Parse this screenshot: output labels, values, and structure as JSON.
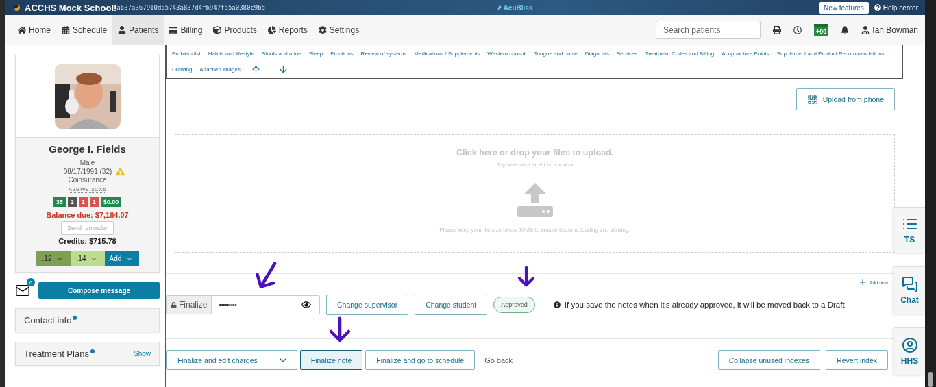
{
  "topbar": {
    "school": "ACCHS Mock School!",
    "hash": "a637a367910d55743a837d4fb947f55a0380c9b5",
    "logo": "AcuBliss",
    "new_features": "New features",
    "help": "Help center"
  },
  "nav": {
    "items": [
      {
        "label": "Home",
        "selected": false
      },
      {
        "label": "Schedule",
        "selected": false
      },
      {
        "label": "Patients",
        "selected": true
      },
      {
        "label": "Billing",
        "selected": false
      },
      {
        "label": "Products",
        "selected": false
      },
      {
        "label": "Reports",
        "selected": false
      },
      {
        "label": "Settings",
        "selected": false
      }
    ],
    "search": {
      "placeholder": "Search patients"
    },
    "badge": "+99",
    "user": "Ian Bowman"
  },
  "section_links": [
    "Problem list",
    "Habits and lifestyle",
    "Stools and urine",
    "Sleep",
    "Emotions",
    "Review of systems",
    "Medications / Supplements",
    "Western consult",
    "Tongue and pulse",
    "Diagnosis",
    "Services",
    "Treatment Codes and Billing",
    "Acupuncture Points",
    "Supplement and Product Recommendations",
    "Drawing",
    "Attached images"
  ],
  "patient": {
    "name": "George I. Fields",
    "sex": "Male",
    "dob": "08/17/1991 (32)",
    "insurance": "Coinsurance",
    "code": "AZBW9-3CX6",
    "counters": [
      {
        "text": "35",
        "color": "#1e8a4c"
      },
      {
        "text": "2",
        "color": "#555555"
      },
      {
        "text": "1",
        "color": "#d9534f"
      },
      {
        "text": "1",
        "color": "#d9534f"
      },
      {
        "text": "$0.00",
        "color": "#1e8a4c"
      }
    ],
    "balance": "Balance due: $7,184.07",
    "send_reminder": "Send reminder",
    "credits": "Credits: $715.78",
    "dropdowns": [
      {
        "label": ".12",
        "color": "#7f9f55"
      },
      {
        "label": ".14",
        "color": "#bcdc90"
      },
      {
        "label": "Add",
        "color": "#0b7ea3"
      }
    ]
  },
  "messages": {
    "count": "6",
    "compose": "Compose message"
  },
  "panels": [
    {
      "title": "Contact info",
      "dot": true
    },
    {
      "title": "Treatment Plans",
      "dot": true,
      "action": "Show"
    }
  ],
  "upload": {
    "button": "Upload from phone",
    "title": "Click here or drop your files to upload.",
    "subtitle": "Tap here on a tablet for camera",
    "note": "Please keep your file size below 10MB to ensure faster uploading and viewing."
  },
  "add_new": "Add new",
  "finalize": {
    "label": "Finalize",
    "value": "•••••••••",
    "buttons": [
      "Change supervisor",
      "Change student"
    ],
    "status": "Approved",
    "info": "If you save the notes when it's already approved, it will be moved back to a Draft"
  },
  "actions": [
    {
      "label": "Finalize and edit charges",
      "kind": "split",
      "selected": false
    },
    {
      "label": "Finalize note",
      "kind": "button",
      "selected": true
    },
    {
      "label": "Finalize and go to schedule",
      "kind": "button",
      "selected": false
    },
    {
      "label": "Go back",
      "kind": "link",
      "selected": false
    }
  ],
  "index_actions": [
    "Collapse unused indexes",
    "Revert index"
  ],
  "side_tabs": [
    {
      "label": "TS"
    },
    {
      "label": "Chat"
    },
    {
      "label": "HHS"
    }
  ]
}
